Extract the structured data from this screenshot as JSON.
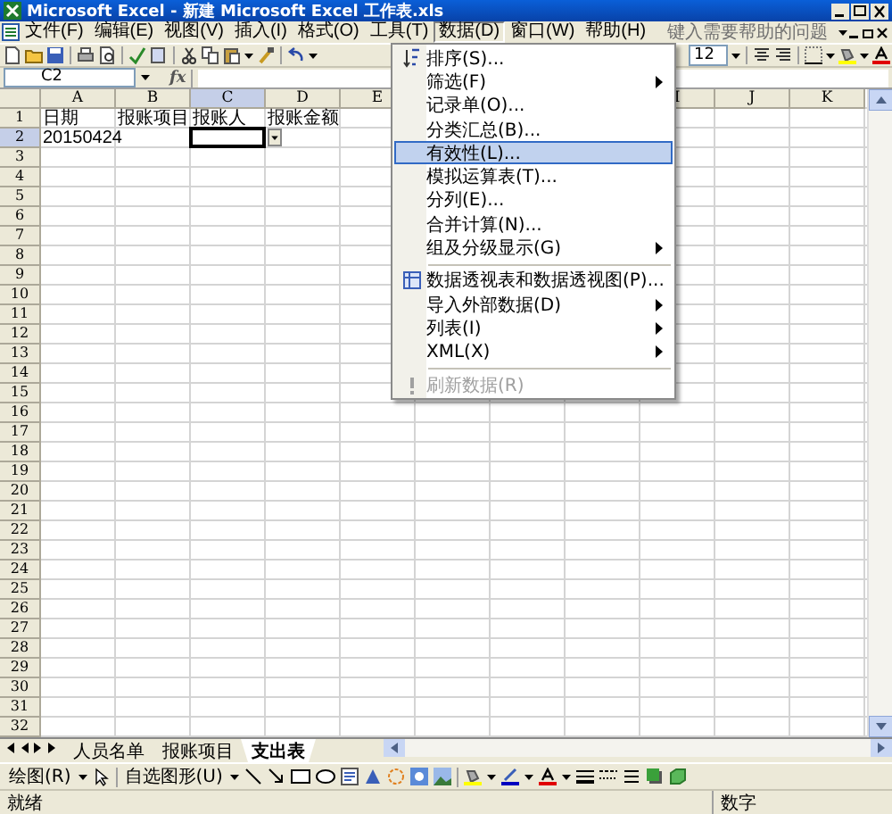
{
  "window": {
    "title": "Microsoft Excel - 新建 Microsoft Excel 工作表.xls"
  },
  "menubar": {
    "items": [
      {
        "label": "文件(F)",
        "selected": false
      },
      {
        "label": "编辑(E)",
        "selected": false
      },
      {
        "label": "视图(V)",
        "selected": false
      },
      {
        "label": "插入(I)",
        "selected": false
      },
      {
        "label": "格式(O)",
        "selected": false
      },
      {
        "label": "工具(T)",
        "selected": false
      },
      {
        "label": "数据(D)",
        "selected": true
      },
      {
        "label": "窗口(W)",
        "selected": false
      },
      {
        "label": "帮助(H)",
        "selected": false
      }
    ],
    "help_box": {
      "placeholder": "键入需要帮助的问题"
    }
  },
  "toolbar": {
    "font_size": "12"
  },
  "formula_bar": {
    "name_box": "C2",
    "function_label": "fx"
  },
  "sheet": {
    "columns": [
      {
        "label": "A",
        "selected": false
      },
      {
        "label": "B",
        "selected": false
      },
      {
        "label": "C",
        "selected": true
      },
      {
        "label": "D",
        "selected": false
      },
      {
        "label": "E",
        "selected": false
      },
      {},
      {},
      {},
      {
        "label": "I",
        "selected": false
      },
      {
        "label": "J",
        "selected": false
      },
      {
        "label": "K",
        "selected": false
      }
    ],
    "rows": [
      {
        "number": "1",
        "selected": false,
        "cells": [
          "日期",
          "报账项目",
          "报账人",
          "报账金额"
        ]
      },
      {
        "number": "2",
        "selected": true,
        "cells": [
          "20150424"
        ]
      },
      {
        "number": "3",
        "selected": false
      },
      {
        "number": "4",
        "selected": false
      },
      {
        "number": "5",
        "selected": false
      },
      {
        "number": "6",
        "selected": false
      },
      {
        "number": "7",
        "selected": false
      },
      {
        "number": "8",
        "selected": false
      },
      {
        "number": "9",
        "selected": false
      },
      {
        "number": "10",
        "selected": false
      },
      {
        "number": "11",
        "selected": false
      },
      {
        "number": "12",
        "selected": false
      },
      {
        "number": "13",
        "selected": false
      },
      {
        "number": "14",
        "selected": false
      },
      {
        "number": "15",
        "selected": false
      },
      {
        "number": "16",
        "selected": false
      },
      {
        "number": "17",
        "selected": false
      },
      {
        "number": "18",
        "selected": false
      },
      {
        "number": "19",
        "selected": false
      },
      {
        "number": "20",
        "selected": false
      },
      {
        "number": "21",
        "selected": false
      },
      {
        "number": "22",
        "selected": false
      },
      {
        "number": "23",
        "selected": false
      },
      {
        "number": "24",
        "selected": false
      },
      {
        "number": "25",
        "selected": false
      },
      {
        "number": "26",
        "selected": false
      },
      {
        "number": "27",
        "selected": false
      },
      {
        "number": "28",
        "selected": false
      },
      {
        "number": "29",
        "selected": false
      },
      {
        "number": "30",
        "selected": false
      },
      {
        "number": "31",
        "selected": false
      },
      {
        "number": "32",
        "selected": false
      }
    ]
  },
  "sheet_tabs": [
    {
      "label": "人员名单",
      "selected": false
    },
    {
      "label": "报账项目",
      "selected": false
    },
    {
      "label": "支出表",
      "selected": true
    }
  ],
  "drawing_toolbar": {
    "draw_menu": "绘图(R)",
    "autoshapes_menu": "自选图形(U)"
  },
  "status_bar": {
    "status": "就绪",
    "mode": "数字"
  },
  "menu": {
    "items": [
      {
        "kind": "command",
        "label": "排序(S)...",
        "selected": false,
        "disabled": false
      },
      {
        "kind": "submenu",
        "label": "筛选(F)",
        "selected": false,
        "disabled": false
      },
      {
        "kind": "command",
        "label": "记录单(O)...",
        "selected": false,
        "disabled": false
      },
      {
        "kind": "command",
        "label": "分类汇总(B)...",
        "selected": false,
        "disabled": false
      },
      {
        "kind": "command",
        "label": "有效性(L)...",
        "selected": true,
        "disabled": false
      },
      {
        "kind": "command",
        "label": "模拟运算表(T)...",
        "selected": false,
        "disabled": false
      },
      {
        "kind": "command",
        "label": "分列(E)...",
        "selected": false,
        "disabled": false
      },
      {
        "kind": "command",
        "label": "合并计算(N)...",
        "selected": false,
        "disabled": false
      },
      {
        "kind": "submenu",
        "label": "组及分级显示(G)",
        "selected": false,
        "disabled": false
      },
      {
        "kind": "separator"
      },
      {
        "kind": "command",
        "label": "数据透视表和数据透视图(P)...",
        "selected": false,
        "disabled": false
      },
      {
        "kind": "submenu",
        "label": "导入外部数据(D)",
        "selected": false,
        "disabled": false
      },
      {
        "kind": "submenu",
        "label": "列表(I)",
        "selected": false,
        "disabled": false
      },
      {
        "kind": "submenu",
        "label": "XML(X)",
        "selected": false,
        "disabled": false
      },
      {
        "kind": "separator"
      },
      {
        "kind": "command",
        "label": "刷新数据(R)",
        "selected": false,
        "disabled": true
      }
    ]
  }
}
